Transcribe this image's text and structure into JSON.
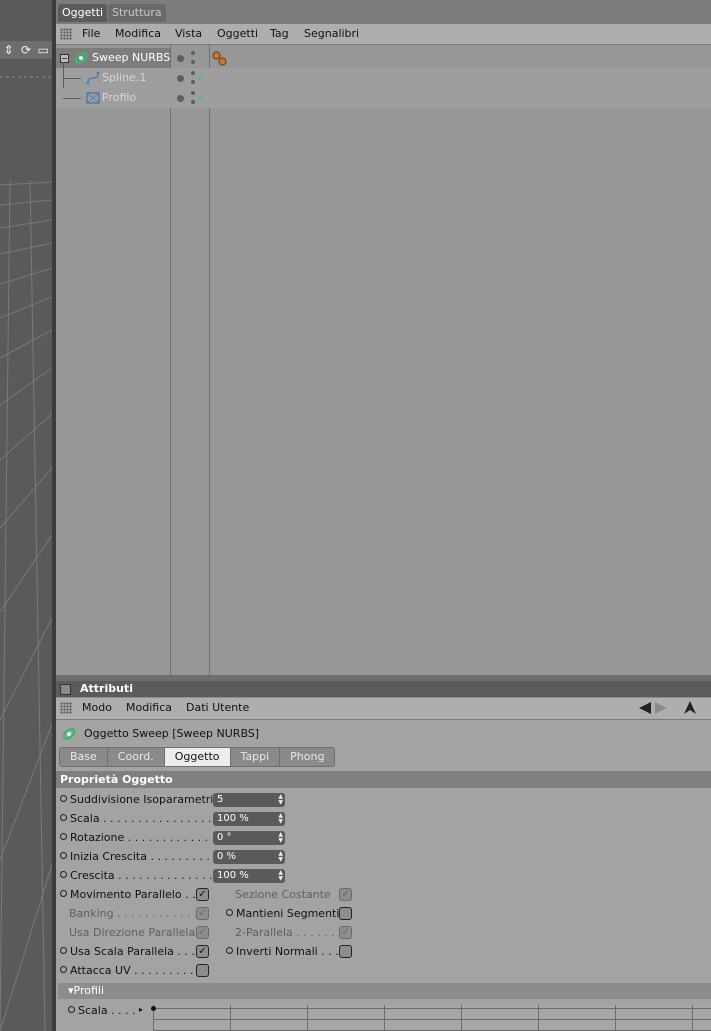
{
  "object_manager": {
    "tabs": [
      "Oggetti",
      "Struttura"
    ],
    "menu": [
      "File",
      "Modifica",
      "Vista",
      "Oggetti",
      "Tag",
      "Segnalibri"
    ],
    "objects": [
      {
        "name": "Sweep NURBS",
        "selected": true
      },
      {
        "name": "Spline.1",
        "selected": false
      },
      {
        "name": "Profilo",
        "selected": false
      }
    ]
  },
  "attributes": {
    "title": "Attributi",
    "menu": [
      "Modo",
      "Modifica",
      "Dati Utente"
    ],
    "object_header": "Oggetto Sweep [Sweep NURBS]",
    "subtabs": [
      "Base",
      "Coord.",
      "Oggetto",
      "Tappi",
      "Phong"
    ],
    "active_subtab": "Oggetto",
    "group_title": "Proprietà Oggetto",
    "fields": [
      {
        "label": "Suddivisione Isoparametri",
        "value": "5"
      },
      {
        "label": "Scala . . . . . . . . . . . . . . . . . . .",
        "value": "100 %"
      },
      {
        "label": "Rotazione . . . . . . . . . . . . . . .",
        "value": "0 °"
      },
      {
        "label": "Inizia Crescita . . . . . . . . . .",
        "value": "0 %"
      },
      {
        "label": "Crescita  . . . . . . . . . . . . . . .",
        "value": "100 %"
      }
    ],
    "checks_left": [
      {
        "label": "Movimento Parallelo . . .",
        "checked": true,
        "enabled": true
      },
      {
        "label": "Banking  . . . . . . . . . . . . .",
        "checked": true,
        "enabled": false
      },
      {
        "label": "Usa Direzione Parallela",
        "checked": true,
        "enabled": false
      },
      {
        "label": "Usa Scala Parallela  . . . .",
        "checked": true,
        "enabled": true
      },
      {
        "label": "Attacca UV . . . . . . . . . . .",
        "checked": false,
        "enabled": true
      }
    ],
    "checks_right": [
      {
        "label": "Sezione Costante",
        "checked": true,
        "enabled": false
      },
      {
        "label": "Mantieni Segmenti",
        "checked": false,
        "enabled": true
      },
      {
        "label": "2-Parallela . . . . . . .",
        "checked": true,
        "enabled": false
      },
      {
        "label": "Inverti Normali  . . .",
        "checked": false,
        "enabled": true
      }
    ],
    "profili_label": "Profili",
    "scala_label": "Scala . . . ."
  },
  "colors": {
    "panel": "#979797",
    "accent_check": "#36c26a"
  }
}
